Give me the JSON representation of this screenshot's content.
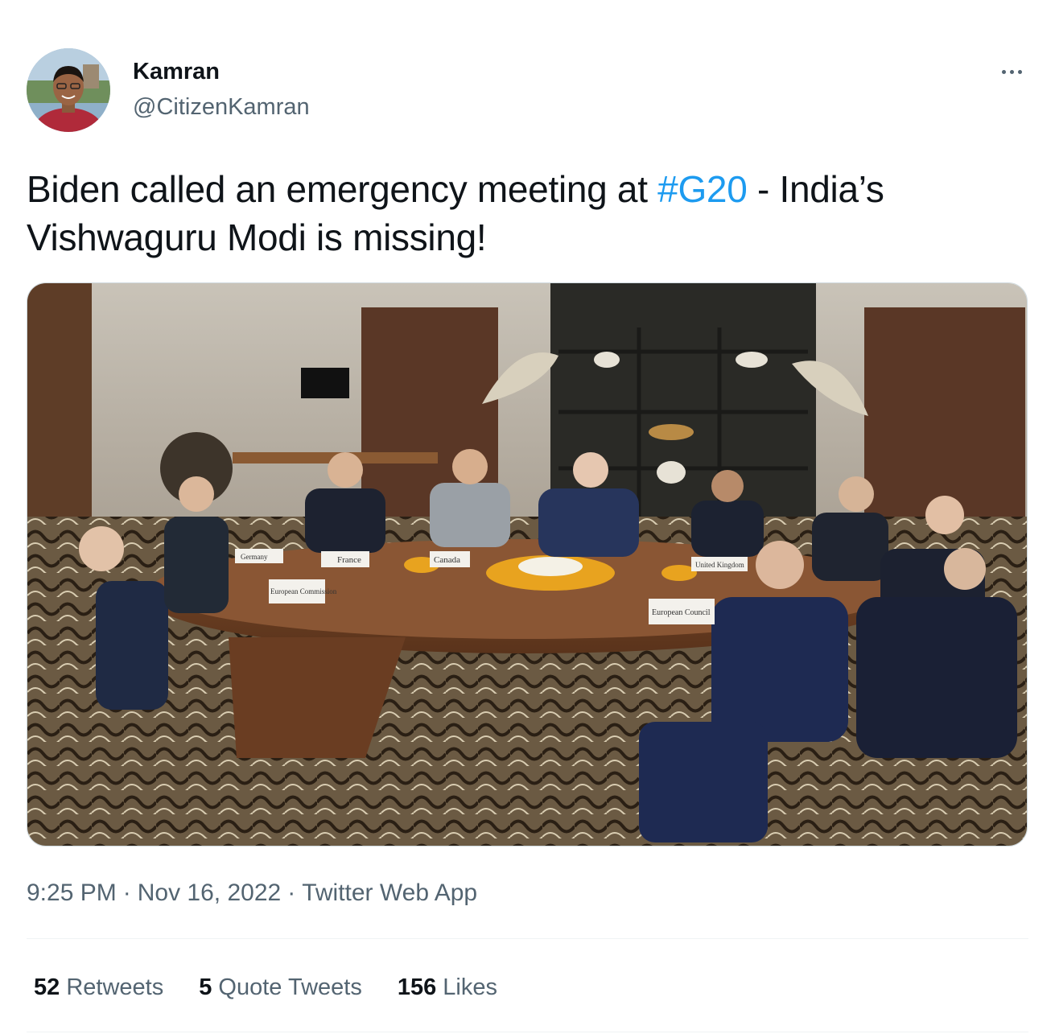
{
  "author": {
    "display_name": "Kamran",
    "handle": "@CitizenKamran"
  },
  "tweet": {
    "text_before": "Biden called an emergency meeting at ",
    "hashtag": "#G20",
    "text_after": " - India’s Vishwaguru Modi is missing!"
  },
  "media": {
    "place_cards": [
      "France",
      "Canada",
      "European Commission",
      "European Council",
      "United Kingdom",
      "Germany"
    ]
  },
  "meta": {
    "time": "9:25 PM",
    "date": "Nov 16, 2022",
    "source": "Twitter Web App",
    "separator": "·"
  },
  "stats": {
    "retweets_count": "52",
    "retweets_label": "Retweets",
    "quotes_count": "5",
    "quotes_label": "Quote Tweets",
    "likes_count": "156",
    "likes_label": "Likes"
  },
  "colors": {
    "link": "#1d9bf0",
    "secondary_text": "#536471",
    "divider": "#eff3f4"
  }
}
